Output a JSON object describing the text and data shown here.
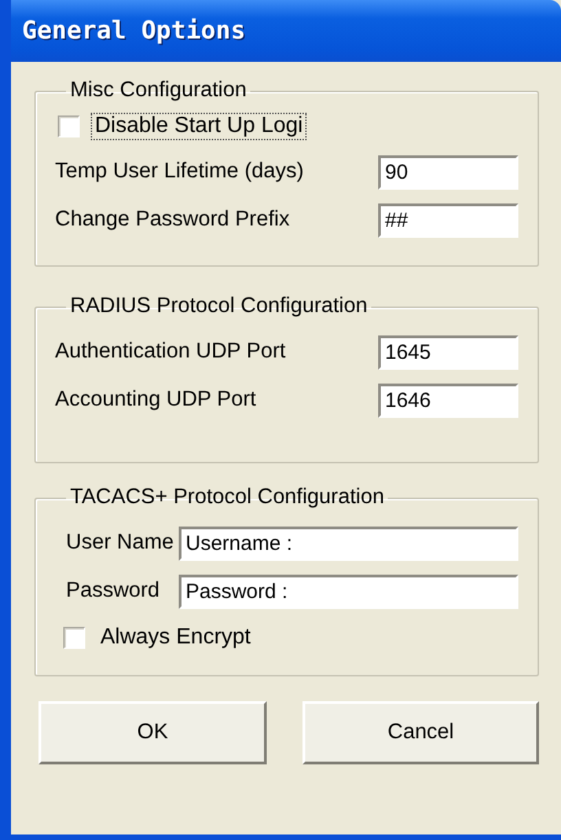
{
  "window": {
    "title": "General Options"
  },
  "groups": [
    {
      "title": "Misc Configuration",
      "rows": [
        {
          "kind": "checkbox",
          "label": "Disable Start Up Logi",
          "checked": false,
          "focused": true
        },
        {
          "kind": "field",
          "label": "Temp User Lifetime (days)",
          "value": "90"
        },
        {
          "kind": "field",
          "label": "Change Password Prefix",
          "value": "##"
        }
      ]
    },
    {
      "title": "RADIUS Protocol Configuration",
      "rows": [
        {
          "kind": "field",
          "label": "Authentication UDP Port",
          "value": "1645"
        },
        {
          "kind": "field",
          "label": "Accounting UDP Port",
          "value": "1646"
        }
      ]
    },
    {
      "title": "TACACS+ Protocol Configuration",
      "rows": [
        {
          "kind": "field",
          "label": "User Name",
          "value": "Username :"
        },
        {
          "kind": "field",
          "label": "Password",
          "value": "Password :"
        },
        {
          "kind": "checkbox",
          "label": "Always Encrypt",
          "checked": false,
          "focused": false
        }
      ]
    }
  ],
  "buttons": [
    "OK",
    "Cancel"
  ]
}
